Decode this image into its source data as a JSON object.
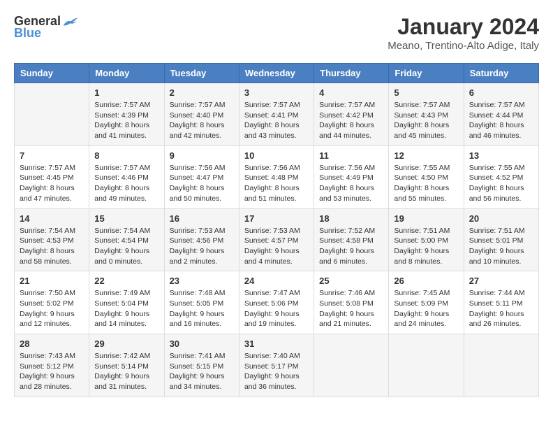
{
  "logo": {
    "general": "General",
    "blue": "Blue"
  },
  "title": "January 2024",
  "subtitle": "Meano, Trentino-Alto Adige, Italy",
  "weekdays": [
    "Sunday",
    "Monday",
    "Tuesday",
    "Wednesday",
    "Thursday",
    "Friday",
    "Saturday"
  ],
  "weeks": [
    [
      {
        "day": "",
        "sunrise": "",
        "sunset": "",
        "daylight": ""
      },
      {
        "day": "1",
        "sunrise": "Sunrise: 7:57 AM",
        "sunset": "Sunset: 4:39 PM",
        "daylight": "Daylight: 8 hours and 41 minutes."
      },
      {
        "day": "2",
        "sunrise": "Sunrise: 7:57 AM",
        "sunset": "Sunset: 4:40 PM",
        "daylight": "Daylight: 8 hours and 42 minutes."
      },
      {
        "day": "3",
        "sunrise": "Sunrise: 7:57 AM",
        "sunset": "Sunset: 4:41 PM",
        "daylight": "Daylight: 8 hours and 43 minutes."
      },
      {
        "day": "4",
        "sunrise": "Sunrise: 7:57 AM",
        "sunset": "Sunset: 4:42 PM",
        "daylight": "Daylight: 8 hours and 44 minutes."
      },
      {
        "day": "5",
        "sunrise": "Sunrise: 7:57 AM",
        "sunset": "Sunset: 4:43 PM",
        "daylight": "Daylight: 8 hours and 45 minutes."
      },
      {
        "day": "6",
        "sunrise": "Sunrise: 7:57 AM",
        "sunset": "Sunset: 4:44 PM",
        "daylight": "Daylight: 8 hours and 46 minutes."
      }
    ],
    [
      {
        "day": "7",
        "sunrise": "Sunrise: 7:57 AM",
        "sunset": "Sunset: 4:45 PM",
        "daylight": "Daylight: 8 hours and 47 minutes."
      },
      {
        "day": "8",
        "sunrise": "Sunrise: 7:57 AM",
        "sunset": "Sunset: 4:46 PM",
        "daylight": "Daylight: 8 hours and 49 minutes."
      },
      {
        "day": "9",
        "sunrise": "Sunrise: 7:56 AM",
        "sunset": "Sunset: 4:47 PM",
        "daylight": "Daylight: 8 hours and 50 minutes."
      },
      {
        "day": "10",
        "sunrise": "Sunrise: 7:56 AM",
        "sunset": "Sunset: 4:48 PM",
        "daylight": "Daylight: 8 hours and 51 minutes."
      },
      {
        "day": "11",
        "sunrise": "Sunrise: 7:56 AM",
        "sunset": "Sunset: 4:49 PM",
        "daylight": "Daylight: 8 hours and 53 minutes."
      },
      {
        "day": "12",
        "sunrise": "Sunrise: 7:55 AM",
        "sunset": "Sunset: 4:50 PM",
        "daylight": "Daylight: 8 hours and 55 minutes."
      },
      {
        "day": "13",
        "sunrise": "Sunrise: 7:55 AM",
        "sunset": "Sunset: 4:52 PM",
        "daylight": "Daylight: 8 hours and 56 minutes."
      }
    ],
    [
      {
        "day": "14",
        "sunrise": "Sunrise: 7:54 AM",
        "sunset": "Sunset: 4:53 PM",
        "daylight": "Daylight: 8 hours and 58 minutes."
      },
      {
        "day": "15",
        "sunrise": "Sunrise: 7:54 AM",
        "sunset": "Sunset: 4:54 PM",
        "daylight": "Daylight: 9 hours and 0 minutes."
      },
      {
        "day": "16",
        "sunrise": "Sunrise: 7:53 AM",
        "sunset": "Sunset: 4:56 PM",
        "daylight": "Daylight: 9 hours and 2 minutes."
      },
      {
        "day": "17",
        "sunrise": "Sunrise: 7:53 AM",
        "sunset": "Sunset: 4:57 PM",
        "daylight": "Daylight: 9 hours and 4 minutes."
      },
      {
        "day": "18",
        "sunrise": "Sunrise: 7:52 AM",
        "sunset": "Sunset: 4:58 PM",
        "daylight": "Daylight: 9 hours and 6 minutes."
      },
      {
        "day": "19",
        "sunrise": "Sunrise: 7:51 AM",
        "sunset": "Sunset: 5:00 PM",
        "daylight": "Daylight: 9 hours and 8 minutes."
      },
      {
        "day": "20",
        "sunrise": "Sunrise: 7:51 AM",
        "sunset": "Sunset: 5:01 PM",
        "daylight": "Daylight: 9 hours and 10 minutes."
      }
    ],
    [
      {
        "day": "21",
        "sunrise": "Sunrise: 7:50 AM",
        "sunset": "Sunset: 5:02 PM",
        "daylight": "Daylight: 9 hours and 12 minutes."
      },
      {
        "day": "22",
        "sunrise": "Sunrise: 7:49 AM",
        "sunset": "Sunset: 5:04 PM",
        "daylight": "Daylight: 9 hours and 14 minutes."
      },
      {
        "day": "23",
        "sunrise": "Sunrise: 7:48 AM",
        "sunset": "Sunset: 5:05 PM",
        "daylight": "Daylight: 9 hours and 16 minutes."
      },
      {
        "day": "24",
        "sunrise": "Sunrise: 7:47 AM",
        "sunset": "Sunset: 5:06 PM",
        "daylight": "Daylight: 9 hours and 19 minutes."
      },
      {
        "day": "25",
        "sunrise": "Sunrise: 7:46 AM",
        "sunset": "Sunset: 5:08 PM",
        "daylight": "Daylight: 9 hours and 21 minutes."
      },
      {
        "day": "26",
        "sunrise": "Sunrise: 7:45 AM",
        "sunset": "Sunset: 5:09 PM",
        "daylight": "Daylight: 9 hours and 24 minutes."
      },
      {
        "day": "27",
        "sunrise": "Sunrise: 7:44 AM",
        "sunset": "Sunset: 5:11 PM",
        "daylight": "Daylight: 9 hours and 26 minutes."
      }
    ],
    [
      {
        "day": "28",
        "sunrise": "Sunrise: 7:43 AM",
        "sunset": "Sunset: 5:12 PM",
        "daylight": "Daylight: 9 hours and 28 minutes."
      },
      {
        "day": "29",
        "sunrise": "Sunrise: 7:42 AM",
        "sunset": "Sunset: 5:14 PM",
        "daylight": "Daylight: 9 hours and 31 minutes."
      },
      {
        "day": "30",
        "sunrise": "Sunrise: 7:41 AM",
        "sunset": "Sunset: 5:15 PM",
        "daylight": "Daylight: 9 hours and 34 minutes."
      },
      {
        "day": "31",
        "sunrise": "Sunrise: 7:40 AM",
        "sunset": "Sunset: 5:17 PM",
        "daylight": "Daylight: 9 hours and 36 minutes."
      },
      {
        "day": "",
        "sunrise": "",
        "sunset": "",
        "daylight": ""
      },
      {
        "day": "",
        "sunrise": "",
        "sunset": "",
        "daylight": ""
      },
      {
        "day": "",
        "sunrise": "",
        "sunset": "",
        "daylight": ""
      }
    ]
  ]
}
